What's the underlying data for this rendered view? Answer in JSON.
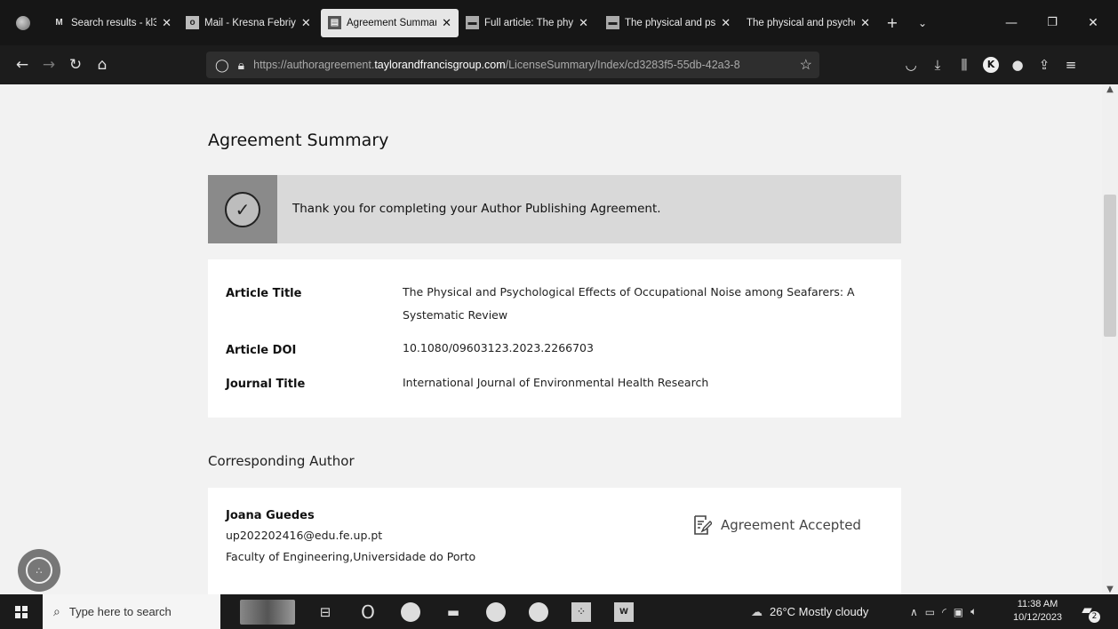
{
  "browser": {
    "tabs": [
      {
        "label": "Search results - kl3",
        "icon": "gmail-icon",
        "active": false
      },
      {
        "label": "Mail - Kresna Febriy",
        "icon": "outlook-icon",
        "active": false
      },
      {
        "label": "Agreement Summar",
        "icon": "document-icon",
        "active": true
      },
      {
        "label": "Full article: The phy",
        "icon": "tandf-icon",
        "active": false
      },
      {
        "label": "The physical and ps",
        "icon": "tandf-icon",
        "active": false
      },
      {
        "label": "The physical and psycho",
        "icon": "none",
        "active": false
      }
    ],
    "url_prefix": "https://authoragreement.",
    "url_host": "taylorandfrancisgroup.com",
    "url_path": "/LicenseSummary/Index/cd3283f5-55db-42a3-8"
  },
  "page": {
    "heading": "Agreement Summary",
    "banner_message": "Thank you for completing your Author Publishing Agreement.",
    "details": {
      "article_title_label": "Article Title",
      "article_title_value": "The Physical and Psychological Effects of Occupational Noise among Seafarers: A Systematic Review",
      "article_doi_label": "Article DOI",
      "article_doi_value": "10.1080/09603123.2023.2266703",
      "journal_title_label": "Journal Title",
      "journal_title_value": "International Journal of Environmental Health Research"
    },
    "corresponding_author_heading": "Corresponding Author",
    "author": {
      "name": "Joana Guedes",
      "email": "up202202416@edu.fe.up.pt",
      "affiliation": "Faculty of Engineering,Universidade do Porto",
      "status": "Agreement Accepted"
    }
  },
  "taskbar": {
    "search_placeholder": "Type here to search",
    "weather": "26°C  Mostly cloudy",
    "time": "11:38 AM",
    "date": "10/12/2023",
    "notification_count": "2"
  }
}
